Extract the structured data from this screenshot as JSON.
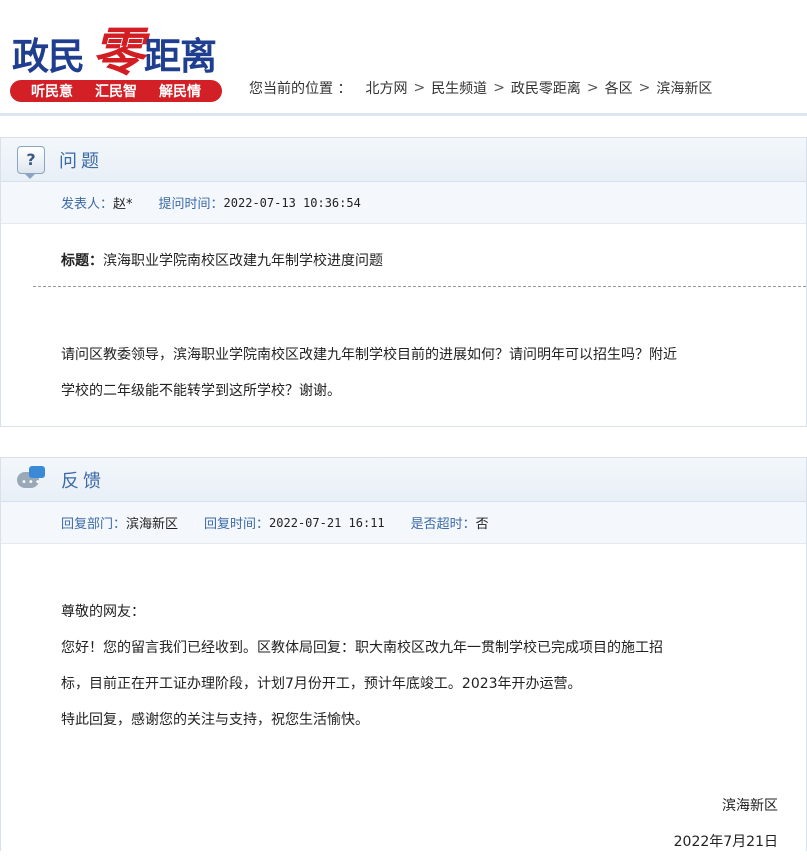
{
  "logo": {
    "title_part1": "政民",
    "title_part2": "零",
    "title_part3": "距离",
    "slogans": [
      "听民意",
      "汇民智",
      "解民情"
    ]
  },
  "breadcrumb": {
    "lead": "您当前的位置 ：",
    "items": [
      "北方网",
      "民生频道",
      "政民零距离",
      "各区",
      "滨海新区"
    ],
    "separator": ">"
  },
  "question": {
    "section_title": "问题",
    "author_label": "发表人：",
    "author_value": "赵*",
    "time_label": "提问时间：",
    "time_value": "2022-07-13 10:36:54",
    "subject_label": "标题：",
    "subject_value": "滨海职业学院南校区改建九年制学校进度问题",
    "body_line1": "请问区教委领导，滨海职业学院南校区改建九年制学校目前的进展如何？请问明年可以招生吗？附近",
    "body_line2": "学校的二年级能不能转学到这所学校？谢谢。"
  },
  "feedback": {
    "section_title": "反馈",
    "dept_label": "回复部门：",
    "dept_value": "滨海新区",
    "time_label": "回复时间：",
    "time_value": "2022-07-21 16:11",
    "overdue_label": "是否超时：",
    "overdue_value": "否",
    "greeting": "尊敬的网友：",
    "line1": "您好！您的留言我们已经收到。区教体局回复：职大南校区改九年一贯制学校已完成项目的施工招",
    "line2": "标，目前正在开工证办理阶段，计划7月份开工，预计年底竣工。2023年开办运营。",
    "line3": "特此回复，感谢您的关注与支持，祝您生活愉快。",
    "sign_org": "滨海新区",
    "sign_date": "2022年7月21日"
  },
  "colors": {
    "brand_blue": "#1f3e8f",
    "brand_red": "#d21d22",
    "accent_blue": "#3b6aa7"
  }
}
